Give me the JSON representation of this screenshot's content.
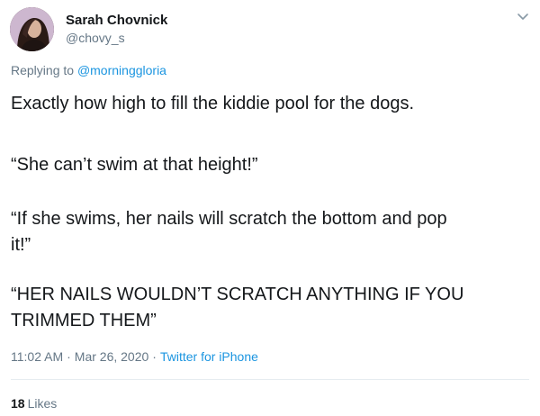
{
  "author": {
    "name": "Sarah Chovnick",
    "handle": "@chovy_s",
    "avatar_icon": "avatar-photo"
  },
  "reply": {
    "prefix": "Replying to",
    "to": "@morninggloria"
  },
  "body_lines": [
    "Exactly how high to fill the kiddie pool for the dogs.",
    "“She can’t swim at that height!”",
    "“If she swims, her nails will scratch the bottom and pop",
    "it!”",
    "“HER NAILS WOULDN’T SCRATCH ANYTHING IF YOU",
    "TRIMMED THEM”"
  ],
  "meta": {
    "time": "11:02 AM",
    "date": "Mar 26, 2020",
    "source": "Twitter for iPhone",
    "separator": "·"
  },
  "stats": {
    "likes_count": "18",
    "likes_label": "Likes"
  },
  "colors": {
    "text": "#14171a",
    "secondary": "#657786",
    "link": "#1b95e0",
    "divider": "#e6ecf0"
  },
  "icons": {
    "menu": "chevron-down-icon"
  }
}
